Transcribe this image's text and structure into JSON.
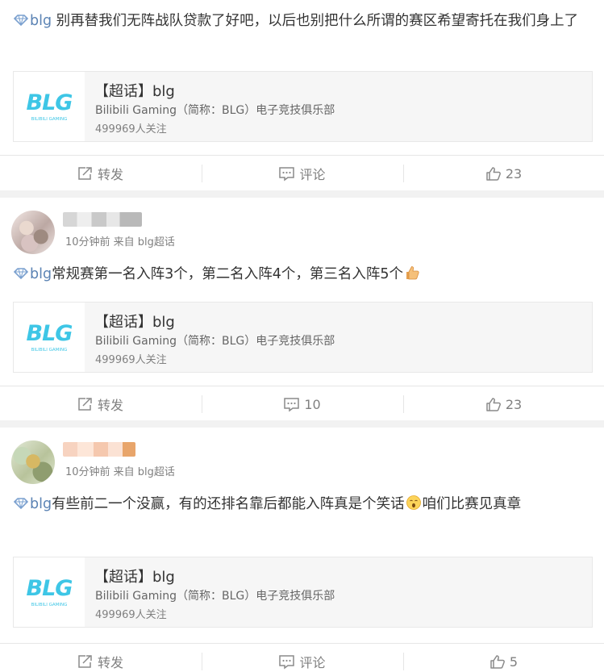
{
  "posts": [
    {
      "text_tag": "blg",
      "text": " 别再替我们无阵战队贷款了好吧，以后也别把什么所谓的赛区希望寄托在我们身上了",
      "card": {
        "title": "【超话】blg",
        "desc": "Bilibili Gaming（简称：BLG）电子竞技俱乐部",
        "followers": "499969人关注"
      },
      "actions": {
        "repost": "转发",
        "comment": "评论",
        "like": "23"
      }
    },
    {
      "meta": "10分钟前 来自 blg超话",
      "text_tag": "blg",
      "text": "常规赛第一名入阵3个，第二名入阵4个，第三名入阵5个",
      "card": {
        "title": "【超话】blg",
        "desc": "Bilibili Gaming（简称：BLG）电子竞技俱乐部",
        "followers": "499969人关注"
      },
      "actions": {
        "repost": "转发",
        "comment": "10",
        "like": "23"
      }
    },
    {
      "meta": "10分钟前 来自 blg超话",
      "text_tag": "blg",
      "text": "有些前二一个没赢，有的还排名靠后都能入阵真是个笑话",
      "text_after": "咱们比赛见真章",
      "card": {
        "title": "【超话】blg",
        "desc": "Bilibili Gaming（简称：BLG）电子竞技俱乐部",
        "followers": "499969人关注"
      },
      "actions": {
        "repost": "转发",
        "comment": "评论",
        "like": "5"
      }
    }
  ],
  "logo_text": {
    "main": "BLG",
    "sub": "BILIBILI GAMING"
  },
  "colors": {
    "tag": "#5b83b4",
    "logo": "#3ec6e6",
    "muted": "#808080",
    "background": "#f2f2f2"
  },
  "icons": [
    "supertopic-gem-icon",
    "repost-icon",
    "comment-icon",
    "like-icon",
    "thumbs-up-emoji",
    "surprised-emoji"
  ]
}
